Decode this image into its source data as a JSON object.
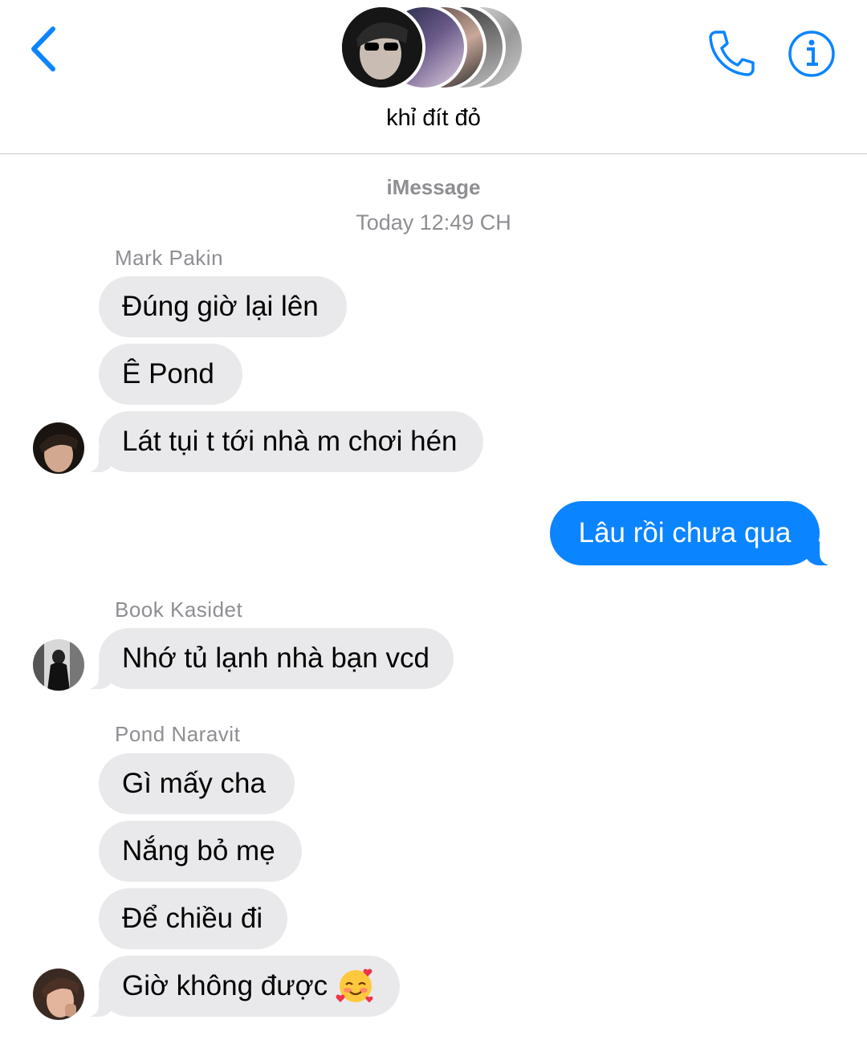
{
  "header": {
    "title": "khỉ đít đỏ",
    "back_icon": "chevron-left-icon",
    "call_icon": "phone-icon",
    "info_icon": "info-icon",
    "accent": "#0b84ff"
  },
  "thread": {
    "service": "iMessage",
    "timestamp": "Today 12:49 CH"
  },
  "groups": [
    {
      "sender": "Mark Pakin",
      "messages": [
        "Đúng giờ lại lên",
        "Ê Pond",
        "Lát tụi t tới nhà m chơi hén"
      ]
    },
    {
      "sender": "",
      "outgoing": true,
      "messages": [
        "Lâu rồi chưa qua"
      ]
    },
    {
      "sender": "Book Kasidet",
      "messages": [
        "Nhớ tủ lạnh nhà bạn vcd"
      ]
    },
    {
      "sender": "Pond Naravit",
      "messages": [
        "Gì mấy cha",
        "Nắng bỏ mẹ",
        "Để chiều đi",
        "Giờ không được"
      ]
    }
  ],
  "colors": {
    "incoming_bubble": "#e9e9eb",
    "outgoing_bubble": "#0b84ff",
    "meta_text": "#8e8e93"
  }
}
